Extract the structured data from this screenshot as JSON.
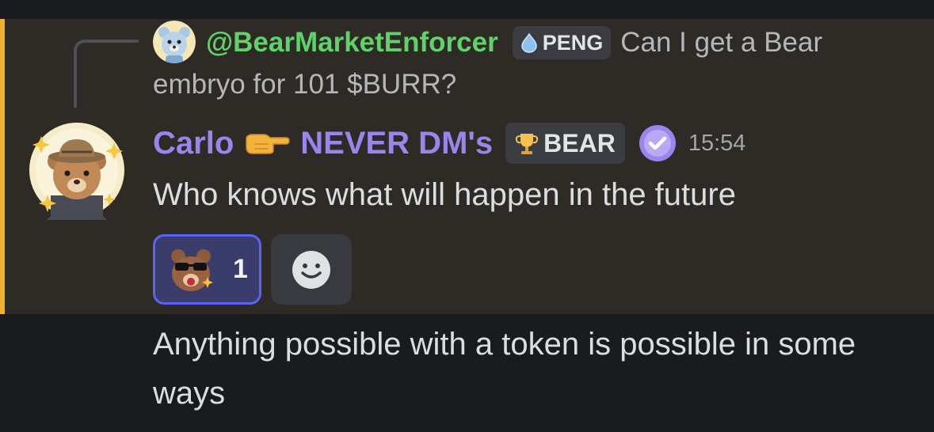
{
  "reply": {
    "author": "@BearMarketEnforcer",
    "role_badge": "PENG",
    "text_line1": "Can I get a Bear",
    "text_line2": "embryo for 101 $BURR?"
  },
  "message": {
    "author_part1": "Carlo",
    "author_emoji": "pointing-hand-emoji",
    "author_part2": "NEVER DM's",
    "role_badge": "BEAR",
    "verified_icon": "verified-check-icon",
    "timestamp": "15:54",
    "text": "Who knows what will happen in the future",
    "reactions": [
      {
        "emoji": "bear-sunglasses-emoji",
        "count": "1",
        "selected": true
      }
    ],
    "add_reaction_icon": "smiley-icon"
  },
  "follow_up": {
    "text": "Anything possible with a token is possible in some ways"
  },
  "colors": {
    "background": "#1a1b1f",
    "highlight_bg": "#2e2a25",
    "mention_accent": "#f0b232",
    "reply_author": "#5fd36a",
    "author": "#9c84ef",
    "reaction_selected": "#5865f2"
  }
}
